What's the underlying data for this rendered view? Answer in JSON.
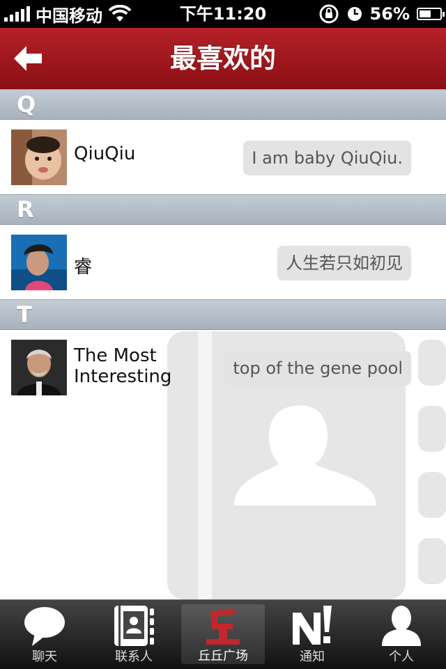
{
  "status_bar": {
    "carrier": "中国移动",
    "time": "下午11:20",
    "battery_text": "56%",
    "battery_level": 0.56
  },
  "nav": {
    "title": "最喜欢的"
  },
  "sections": [
    {
      "letter": "Q",
      "contacts": [
        {
          "name": "QiuQiu",
          "status": "I am baby QiuQiu."
        }
      ]
    },
    {
      "letter": "R",
      "contacts": [
        {
          "name": "睿",
          "status": "人生若只如初见"
        }
      ]
    },
    {
      "letter": "T",
      "contacts": [
        {
          "name": "The Most Interesting",
          "status": "top of the gene pool"
        }
      ]
    }
  ],
  "tabs": [
    {
      "label": "聊天",
      "icon": "chat-bubble-icon",
      "active": false
    },
    {
      "label": "联系人",
      "icon": "contacts-book-icon",
      "active": false
    },
    {
      "label": "丘丘广场",
      "icon": "qiu-square-icon",
      "active": true
    },
    {
      "label": "通知",
      "icon": "notification-icon",
      "active": false
    },
    {
      "label": "个人",
      "icon": "person-icon",
      "active": false
    }
  ],
  "colors": {
    "nav_red": "#9b151b",
    "tab_active_icon": "#c0282e"
  }
}
